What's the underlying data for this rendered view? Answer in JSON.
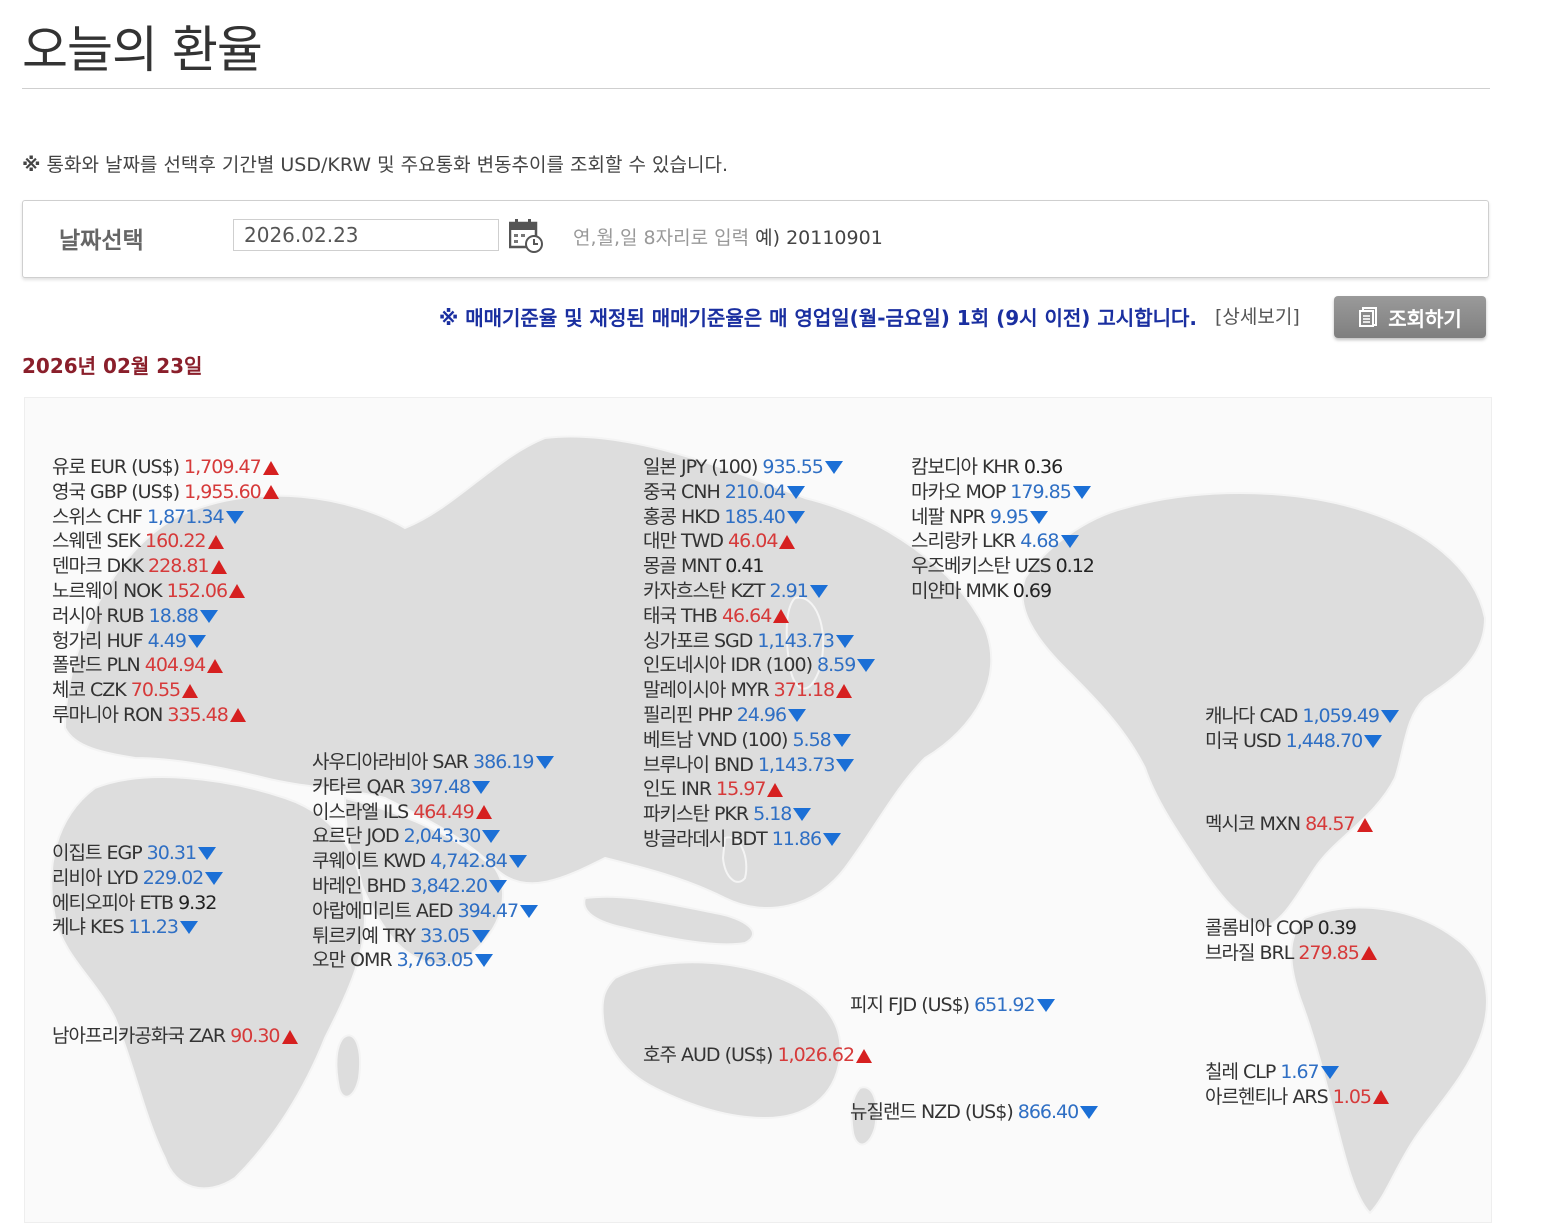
{
  "page": {
    "title": "오늘의 환율",
    "note_mark": "※",
    "note": "통화와 날짜를 선택후 기간별 USD/KRW 및 주요통화 변동추이를 조회할 수 있습니다."
  },
  "date_select": {
    "label": "날짜선택",
    "value": "2026.02.23",
    "hint": "연,월,일 8자리로 입력",
    "example": "예) 20110901"
  },
  "notice": "※ 매매기준율 및 재정된 매매기준율은 매 영업일(월-금요일) 1회 (9시 이전) 고시합니다.",
  "detail_link": "[상세보기]",
  "search_button": "조회하기",
  "date_heading": "2026년 02월 23일",
  "groups": {
    "europe": [
      {
        "name": "유로 EUR (US$)",
        "value": "1,709.47",
        "trend": "up"
      },
      {
        "name": "영국 GBP (US$)",
        "value": "1,955.60",
        "trend": "up"
      },
      {
        "name": "스위스 CHF",
        "value": "1,871.34",
        "trend": "down"
      },
      {
        "name": "스웨덴 SEK",
        "value": "160.22",
        "trend": "up"
      },
      {
        "name": "덴마크 DKK",
        "value": "228.81",
        "trend": "up"
      },
      {
        "name": "노르웨이 NOK",
        "value": "152.06",
        "trend": "up"
      },
      {
        "name": "러시아 RUB",
        "value": "18.88",
        "trend": "down"
      },
      {
        "name": "헝가리 HUF",
        "value": "4.49",
        "trend": "down"
      },
      {
        "name": "폴란드 PLN",
        "value": "404.94",
        "trend": "up"
      },
      {
        "name": "체코 CZK",
        "value": "70.55",
        "trend": "up"
      },
      {
        "name": "루마니아 RON",
        "value": "335.48",
        "trend": "up"
      }
    ],
    "africa": [
      {
        "name": "이집트 EGP",
        "value": "30.31",
        "trend": "down"
      },
      {
        "name": "리비아 LYD",
        "value": "229.02",
        "trend": "down"
      },
      {
        "name": "에티오피아 ETB",
        "value": "9.32",
        "trend": "none"
      },
      {
        "name": "케냐 KES",
        "value": "11.23",
        "trend": "down"
      }
    ],
    "south_africa": [
      {
        "name": "남아프리카공화국 ZAR",
        "value": "90.30",
        "trend": "up"
      }
    ],
    "middle_east": [
      {
        "name": "사우디아라비아 SAR",
        "value": "386.19",
        "trend": "down"
      },
      {
        "name": "카타르 QAR",
        "value": "397.48",
        "trend": "down"
      },
      {
        "name": "이스라엘 ILS",
        "value": "464.49",
        "trend": "up"
      },
      {
        "name": "요르단 JOD",
        "value": "2,043.30",
        "trend": "down"
      },
      {
        "name": "쿠웨이트 KWD",
        "value": "4,742.84",
        "trend": "down"
      },
      {
        "name": "바레인 BHD",
        "value": "3,842.20",
        "trend": "down"
      },
      {
        "name": "아랍에미리트 AED",
        "value": "394.47",
        "trend": "down"
      },
      {
        "name": "튀르키예 TRY",
        "value": "33.05",
        "trend": "down"
      },
      {
        "name": "오만 OMR",
        "value": "3,763.05",
        "trend": "down"
      }
    ],
    "asia": [
      {
        "name": "일본 JPY (100)",
        "value": "935.55",
        "trend": "down"
      },
      {
        "name": "중국 CNH",
        "value": "210.04",
        "trend": "down"
      },
      {
        "name": "홍콩 HKD",
        "value": "185.40",
        "trend": "down"
      },
      {
        "name": "대만 TWD",
        "value": "46.04",
        "trend": "up"
      },
      {
        "name": "몽골 MNT",
        "value": "0.41",
        "trend": "none"
      },
      {
        "name": "카자흐스탄 KZT",
        "value": "2.91",
        "trend": "down"
      },
      {
        "name": "태국 THB",
        "value": "46.64",
        "trend": "up"
      },
      {
        "name": "싱가포르 SGD",
        "value": "1,143.73",
        "trend": "down"
      },
      {
        "name": "인도네시아 IDR (100)",
        "value": "8.59",
        "trend": "down"
      },
      {
        "name": "말레이시아 MYR",
        "value": "371.18",
        "trend": "up"
      },
      {
        "name": "필리핀 PHP",
        "value": "24.96",
        "trend": "down"
      },
      {
        "name": "베트남 VND (100)",
        "value": "5.58",
        "trend": "down"
      },
      {
        "name": "브루나이 BND",
        "value": "1,143.73",
        "trend": "down"
      },
      {
        "name": "인도 INR",
        "value": "15.97",
        "trend": "up"
      },
      {
        "name": "파키스탄 PKR",
        "value": "5.18",
        "trend": "down"
      },
      {
        "name": "방글라데시 BDT",
        "value": "11.86",
        "trend": "down"
      }
    ],
    "asia2": [
      {
        "name": "캄보디아 KHR",
        "value": "0.36",
        "trend": "none"
      },
      {
        "name": "마카오 MOP",
        "value": "179.85",
        "trend": "down"
      },
      {
        "name": "네팔 NPR",
        "value": "9.95",
        "trend": "down"
      },
      {
        "name": "스리랑카 LKR",
        "value": "4.68",
        "trend": "down"
      },
      {
        "name": "우즈베키스탄 UZS",
        "value": "0.12",
        "trend": "none"
      },
      {
        "name": "미얀마 MMK",
        "value": "0.69",
        "trend": "none"
      }
    ],
    "fiji": [
      {
        "name": "피지 FJD (US$)",
        "value": "651.92",
        "trend": "down"
      }
    ],
    "australia": [
      {
        "name": "호주 AUD (US$)",
        "value": "1,026.62",
        "trend": "up"
      }
    ],
    "nz": [
      {
        "name": "뉴질랜드 NZD (US$)",
        "value": "866.40",
        "trend": "down"
      }
    ],
    "north_america": [
      {
        "name": "캐나다 CAD",
        "value": "1,059.49",
        "trend": "down"
      },
      {
        "name": "미국 USD",
        "value": "1,448.70",
        "trend": "down"
      }
    ],
    "mexico": [
      {
        "name": "멕시코 MXN",
        "value": "84.57",
        "trend": "up"
      }
    ],
    "south_america": [
      {
        "name": "콜롬비아 COP",
        "value": "0.39",
        "trend": "none"
      },
      {
        "name": "브라질 BRL",
        "value": "279.85",
        "trend": "up"
      }
    ],
    "south_america2": [
      {
        "name": "칠레 CLP",
        "value": "1.67",
        "trend": "down"
      },
      {
        "name": "아르헨티나 ARS",
        "value": "1.05",
        "trend": "up"
      }
    ]
  },
  "colors": {
    "up": "#d63a3a",
    "down": "#2f6fc4",
    "notice": "#1a2fa0",
    "date_heading": "#8a1f2b"
  }
}
